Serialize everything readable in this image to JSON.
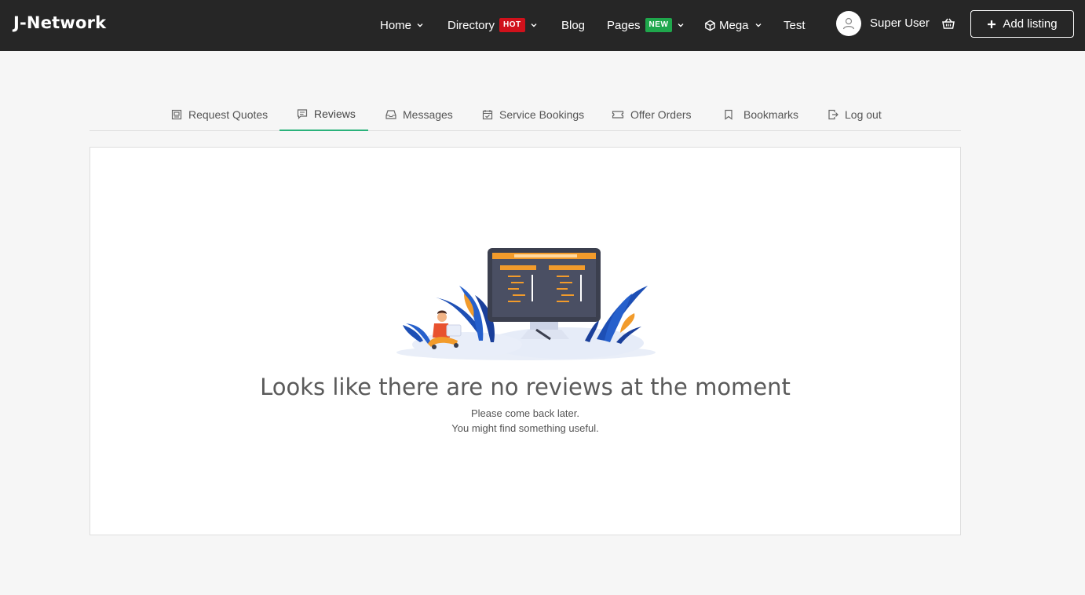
{
  "brand": "J-Network",
  "nav": {
    "home": "Home",
    "directory": "Directory",
    "directory_badge": "HOT",
    "blog": "Blog",
    "pages": "Pages",
    "pages_badge": "NEW",
    "mega": "Mega",
    "test": "Test"
  },
  "user": {
    "name": "Super User"
  },
  "add_listing": "Add listing",
  "tabs": [
    {
      "label": "Request Quotes",
      "icon": "quote-icon"
    },
    {
      "label": "Reviews",
      "icon": "review-icon",
      "active": true
    },
    {
      "label": "Messages",
      "icon": "inbox-icon"
    },
    {
      "label": "Service Bookings",
      "icon": "calendar-check-icon"
    },
    {
      "label": "Offer Orders",
      "icon": "ticket-icon"
    },
    {
      "label": "Bookmarks",
      "icon": "bookmark-icon"
    },
    {
      "label": "Log out",
      "icon": "logout-icon"
    }
  ],
  "empty": {
    "title": "Looks like there are no reviews at the moment",
    "line1": "Please come back later.",
    "line2": "You might find something useful."
  },
  "colors": {
    "navbar": "#262626",
    "accent": "#2ab27b",
    "hot": "#d0111b",
    "new": "#1fa74c",
    "illustration_orange": "#f29b2b",
    "illustration_blue": "#1d4fb5"
  }
}
